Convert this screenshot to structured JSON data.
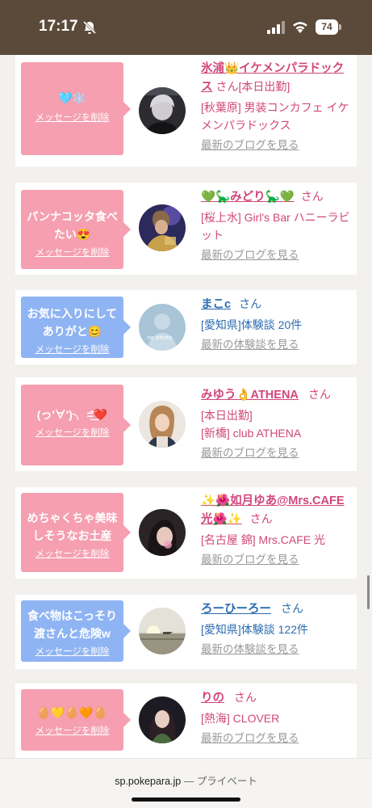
{
  "status_bar": {
    "time": "17:17",
    "battery": "74"
  },
  "cards": [
    {
      "bubble_color": "pink",
      "message": "🩵❄️",
      "delete_label": "メッセージを削除",
      "name_color": "pink",
      "name": "氷浦👑イケメンパラドックス",
      "san": "さん",
      "inline_detail": "[本日出勤]",
      "details": [
        "[秋葉原] 男装コンカフェ イケメンパラドックス"
      ],
      "link_label": "最新のブログを見る"
    },
    {
      "bubble_color": "pink",
      "message": "パンナコッタ食べたい😍",
      "delete_label": "メッセージを削除",
      "name_color": "pink",
      "name": "💚🦕みどり🦕💚",
      "san": "さん",
      "inline_detail": "",
      "details": [
        "[桜上水] Girl's Bar ハニーラビット"
      ],
      "link_label": "最新のブログを見る"
    },
    {
      "bubble_color": "blue",
      "message": "お気に入りにしてありがと😊",
      "delete_label": "メッセージを削除",
      "name_color": "blue",
      "name": "まこc",
      "san": "さん",
      "inline_detail": "",
      "details": [
        "[愛知県]体験談 20件"
      ],
      "link_label": "最新の体験談を見る",
      "avatar_text": "no photo"
    },
    {
      "bubble_color": "pink",
      "message": "(っ'∀')╮ =͟͟͞͞❤️",
      "delete_label": "メッセージを削除",
      "name_color": "pink",
      "name": "みゆう👌ATHENA",
      "san": "さん",
      "inline_detail": "",
      "details": [
        "[本日出勤]",
        "[新橋] club ATHENA"
      ],
      "link_label": "最新のブログを見る"
    },
    {
      "bubble_color": "pink",
      "message": "めちゃくちゃ美味しそうなお土産",
      "delete_label": "メッセージを削除",
      "name_color": "pink",
      "name": "✨🌺如月ゆあ@Mrs.CAFE光🌺✨",
      "san": "さん",
      "inline_detail": "",
      "details": [
        "[名古屋 錦] Mrs.CAFE 光"
      ],
      "link_label": "最新のブログを見る"
    },
    {
      "bubble_color": "blue",
      "message": "食べ物はこっそり渡さんと危険w",
      "delete_label": "メッセージを削除",
      "name_color": "blue",
      "name": "ろーひーろー",
      "san": "さん",
      "inline_detail": "",
      "details": [
        "[愛知県]体験談 122件"
      ],
      "link_label": "最新の体験談を見る"
    },
    {
      "bubble_color": "pink",
      "message": "🥚💛🥚🧡🥚",
      "delete_label": "メッセージを削除",
      "name_color": "pink",
      "name": "りの",
      "san": "さん",
      "inline_detail": "",
      "details": [
        "[熱海] CLOVER"
      ],
      "link_label": "最新のブログを見る"
    }
  ],
  "browser": {
    "domain": "sp.pokepara.jp",
    "separator": "—",
    "mode": "プライベート"
  }
}
